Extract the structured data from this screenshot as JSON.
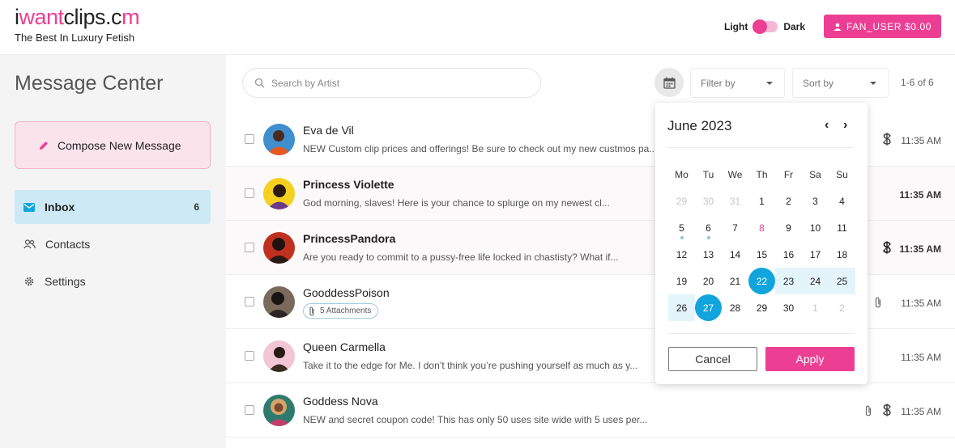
{
  "header": {
    "logo_pre": "i",
    "logo_mid": "want",
    "logo_post": "clips.c",
    "logo_end": "m",
    "tagline": "The Best In Luxury Fetish",
    "theme_light": "Light",
    "theme_dark": "Dark",
    "user_button": "FAN_USER $0.00"
  },
  "sidebar": {
    "title": "Message Center",
    "compose_label": "Compose New Message",
    "items": [
      {
        "label": "Inbox",
        "badge": "6"
      },
      {
        "label": "Contacts"
      },
      {
        "label": "Settings"
      }
    ]
  },
  "toolbar": {
    "search_placeholder": "Search by Artist",
    "filter_label": "Filter by",
    "sort_label": "Sort by",
    "pagination": "1-6 of 6"
  },
  "messages": [
    {
      "sender": "Eva de Vil",
      "preview": "NEW Custom clip prices and offerings! Be sure to check out my new custmos pa...",
      "time": "11:35 AM"
    },
    {
      "sender": "Princess Violette",
      "preview": "God morning, slaves! Here is your chance to splurge on my newest cl...",
      "time": "11:35 AM"
    },
    {
      "sender": "PrincessPandora",
      "preview": "Are you ready to commit to a pussy-free life locked in chastisty? What if...",
      "time": "11:35 AM"
    },
    {
      "sender": "GooddessPoison",
      "attachments": "5 Attachments",
      "time": "11:35 AM"
    },
    {
      "sender": "Queen Carmella",
      "preview": "Take it to the edge for Me. I don’t think you’re pushing yourself as much as y...",
      "time": "11:35 AM"
    },
    {
      "sender": "Goddess Nova",
      "preview": "NEW and secret coupon code! This has only 50 uses site wide with 5 uses per...",
      "time": "11:35 AM"
    }
  ],
  "calendar": {
    "month": "June 2023",
    "prev": "‹",
    "next": "›",
    "weekdays": [
      "Mo",
      "Tu",
      "We",
      "Th",
      "Fr",
      "Sa",
      "Su"
    ],
    "days": [
      "29",
      "30",
      "31",
      "1",
      "2",
      "3",
      "4",
      "5",
      "6",
      "7",
      "8",
      "9",
      "10",
      "11",
      "12",
      "13",
      "14",
      "15",
      "16",
      "17",
      "18",
      "19",
      "20",
      "21",
      "22",
      "23",
      "24",
      "25",
      "26",
      "27",
      "28",
      "29",
      "30",
      "1",
      "2"
    ],
    "cancel": "Cancel",
    "apply": "Apply"
  },
  "colors": {
    "brand_pink": "#ec3f93",
    "accent_blue": "#12a5dd",
    "inbox_bg": "#cde9f6"
  }
}
